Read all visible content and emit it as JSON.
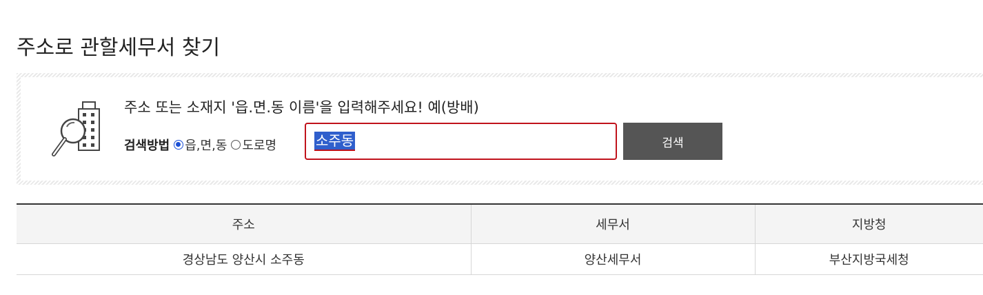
{
  "page": {
    "title": "주소로 관할세무서 찾기"
  },
  "search": {
    "instruction": "주소 또는 소재지 '읍.면.동 이름'을 입력해주세요! 예(방배)",
    "method_label": "검색방법",
    "options": [
      {
        "label": "읍,면,동",
        "checked": true
      },
      {
        "label": "도로명",
        "checked": false
      }
    ],
    "query": "소주동",
    "button_label": "검색",
    "icon": "building-magnifier-icon"
  },
  "results": {
    "columns": [
      "주소",
      "세무서",
      "지방청"
    ],
    "rows": [
      [
        "경상남도 양산시 소주동",
        "양산세무서",
        "부산지방국세청"
      ]
    ]
  },
  "colors": {
    "accent_input_border": "#c0121b",
    "selection": "#2f5fcc",
    "button_bg": "#555555",
    "radio_checked": "#1a4fd6"
  }
}
